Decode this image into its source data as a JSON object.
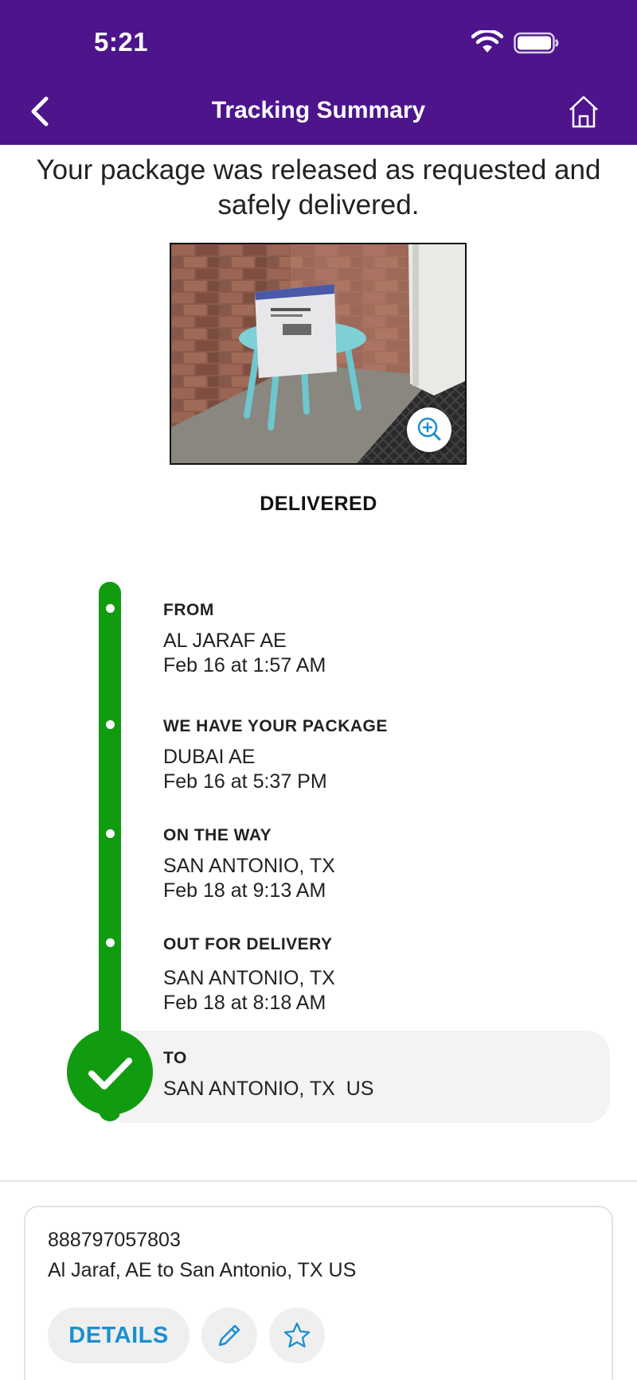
{
  "status_bar": {
    "time": "5:21",
    "icons": [
      "wifi-icon",
      "battery-icon"
    ]
  },
  "nav": {
    "title": "Tracking Summary",
    "back_icon": "chevron-left-icon",
    "home_icon": "home-icon"
  },
  "message": "Your package was released as requested and safely delivered.",
  "photo": {
    "description_icon": "zoom-in-icon"
  },
  "status": "DELIVERED",
  "steps": [
    {
      "label": "FROM",
      "line1": "AL JARAF AE",
      "line2": "Feb 16 at 1:57 AM"
    },
    {
      "label": "WE HAVE YOUR PACKAGE",
      "line1": "DUBAI AE",
      "line2": "Feb 16 at 5:37 PM"
    },
    {
      "label": "ON THE WAY",
      "line1": "SAN ANTONIO, TX",
      "line2": "Feb 18 at 9:13 AM"
    },
    {
      "label": "OUT FOR DELIVERY",
      "line1": "SAN ANTONIO, TX",
      "line2": "Feb 18 at 8:18 AM"
    },
    {
      "label": "TO",
      "line1": "SAN ANTONIO, TX  US"
    }
  ],
  "shipment": {
    "tracking_number": "888797057803",
    "route": "Al Jaraf, AE to San Antonio, TX US",
    "details_label": "DETAILS",
    "edit_icon": "pencil-icon",
    "favorite_icon": "star-icon"
  },
  "colors": {
    "header": "#4d148c",
    "progress": "#119b10",
    "link": "#1a8fd1"
  }
}
